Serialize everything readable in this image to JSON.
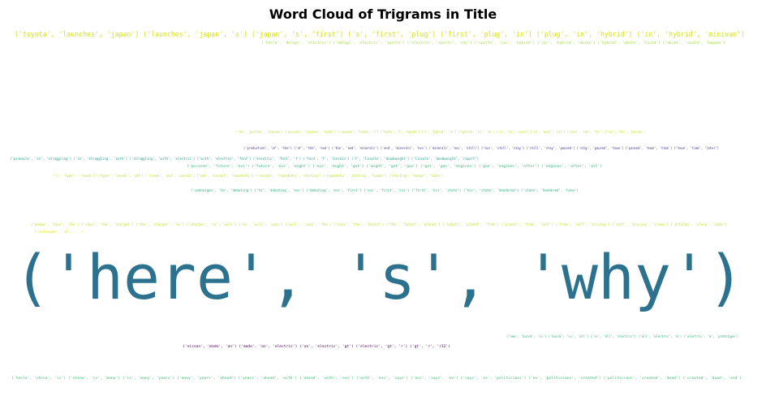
{
  "chart_data": {
    "type": "wordcloud",
    "title": "Word Cloud of Trigrams in Title",
    "background": "#ffffff",
    "colormap": "viridis",
    "words": [
      {
        "text": "('here', 's', 'why')",
        "color": "#2c728e"
      },
      {
        "text": "('toyota', 'launches', 'japan') ('launches', 'japan', 's') ('japan', 's', 'first') ('s', 'first', 'plug') ('first', 'plug', 'in') ('plug', 'in', 'hybrid') ('in', 'hybrid', 'minivan')",
        "color": "#d8e219"
      },
      {
        "text": "('tesla', 'delays', 'electric') ('delays', 'electric', 'sports') ('electric', 'sports', 'car') ('sports', 'car', 'hybrid') ('car', 'hybrid', 'ebike') ('hybrid', 'ebike', 'could') ('ebike', 'could', 'happen')",
        "color": "#a0da39"
      },
      {
        "text": "('the', 'porsche', 'cayenne') ('porsche', 'cayenne', 'turbo') ('cayenne', 'turbo', 's') ('turbo', 's', 'hybrid') ('s', 'hybrid', 'is') ('hybrid', 'is', 'so') ('is', 'so', 'much') ('so', 'much', 'car') ('much', 'car', 'for') ('car', 'for', 'review')",
        "color": "#bddf26"
      },
      {
        "text": "('production', 'of', 'the') ('of', 'the', 'end') ('the', 'end', 'minerals') ('end', 'minerals', 'evs') ('minerals', 'evs', 'still') ('evs', 'still', 'stay') ('still', 'stay', 'paused') ('stay', 'paused', 'town') ('paused', 'town', 'time') ('town', 'time', 'later')",
        "color": "#46327e"
      },
      {
        "text": "('pinnacle', 'in', 'struggling') ('in', 'struggling', 'with') ('struggling', 'with', 'electric') ('with', 'electric', 'ford') ('electric', 'ford', 'f') ('ford', 'f', 'lincoln') ('f', 'lincoln', 'deadweight') ('lincoln', 'deadweight', 'report')",
        "color": "#1f9e89"
      },
      {
        "text": "('porsche', 'future', 'evs') ('future', 'evs', 'might') ('evs', 'might', 'get') ('might', 'get', 'gas') ('get', 'gas', 'engines') ('gas', 'engines', 'after') ('engines', 'after', 'all')",
        "color": "#35b779"
      },
      {
        "text": "('s', 'hyper', 'reveal') ('hyper', 'reveal', 'and') ('reveal', 'and', 'concept') ('and', 'concept', 'repeatedly') ('concept', 'repeatedly', 'starting') ('repeatedly', 'starting', 'hunger') ('starting', 'hunger', 'table')",
        "color": "#b5de2b"
      },
      {
        "text": "('sedanigan', 'to', 'debuting') ('to', 'debuting', 'evs') ('debuting', 'evs', 'first') ('evs', 'first', 'his') ('first', 'his', 'state') ('his', 'state', 'Vendered') ('state', 'Vendered', 'hike')",
        "color": "#25ab82"
      },
      {
        "text": "('dodge', 'says', 'the') ('says', 'the', 'charger') ('the', 'charger', 'ev') ('charger', 'ev', 'will') ('ev', 'will', 'soon') ('will', 'soon', 'the') ('soon', 'the', 'latest') ('the', 'latest', 'planet') ('latest', 'planet', 'from') ('planet', 'from', 'self') ('from', 'self', 'driving') ('self', 'driving', 'sleep') ('driving', 'sleep', 'pods')",
        "color": "#c0df25"
      },
      {
        "text": "('volkswagen', 'id', '...')",
        "color": "#e5e419"
      },
      {
        "text": "('new', 'buick', 'is') ('buick', 'is', 'all') ('is', 'all', 'electric') ('all', 'electric', 'm') ('electric', 'm', 'prototype')",
        "color": "#2db27d"
      },
      {
        "text": "('nissan', 'made', 'an') ('made', 'an', 'electric') ('an', 'electric', 'gt') ('electric', 'gt', 'r') ('gt', 'r', 'r32')",
        "color": "#440154"
      },
      {
        "text": "('tesla', 'china', 'is') ('china', 'is', 'many') ('is', 'many', 'years') ('many', 'years', 'ahead') ('years', 'ahead', 'with') ('ahead', 'with', 'evs') ('with', 'evs', 'says') ('evs', 'says', 'ev') ('says', 'ev', 'politicians') ('ev', 'politicians', 'created') ('politicians', 'created', 'dead') ('created', 'dead', 'end')",
        "color": "#3bbb75"
      }
    ]
  }
}
